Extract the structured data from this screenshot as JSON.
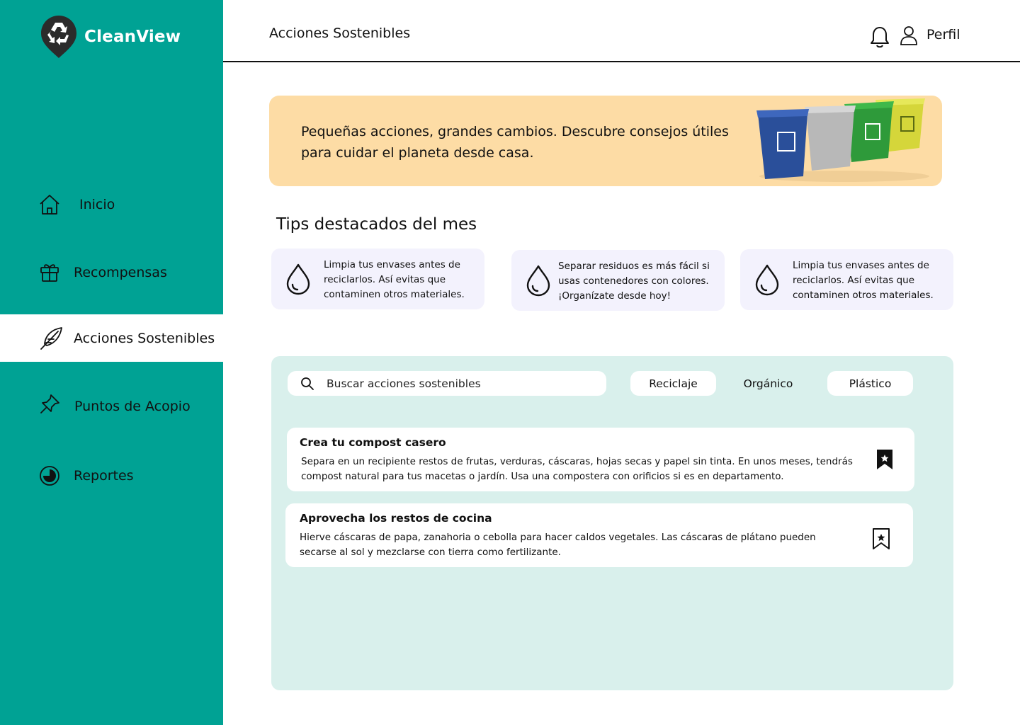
{
  "app": {
    "name": "CleanView"
  },
  "colors": {
    "sidebar": "#00A294",
    "banner": "#FDDCA5",
    "tip_card": "#F3F2FD",
    "panel": "#D9F0EC"
  },
  "sidebar": {
    "items": [
      {
        "label": "Inicio",
        "icon": "home-icon",
        "active": false
      },
      {
        "label": "Recompensas",
        "icon": "gift-icon",
        "active": false
      },
      {
        "label": "Acciones Sostenibles",
        "icon": "feather-icon",
        "active": true
      },
      {
        "label": "Puntos de Acopio",
        "icon": "pushpin-icon",
        "active": false
      },
      {
        "label": "Reportes",
        "icon": "pie-chart-icon",
        "active": false
      }
    ]
  },
  "header": {
    "title": "Acciones Sostenibles",
    "profile_label": "Perfil"
  },
  "banner": {
    "text": "Pequeñas acciones, grandes cambios. Descubre consejos útiles para cuidar el planeta desde casa."
  },
  "tips": {
    "title": "Tips destacados del mes",
    "items": [
      {
        "text": "Limpia tus envases antes de reciclarlos. Así evitas que contaminen otros materiales."
      },
      {
        "text": "Separar residuos es más fácil si usas contenedores con colores. ¡Organízate desde hoy!"
      },
      {
        "text": "Limpia tus envases antes de reciclarlos. Así evitas que contaminen otros materiales."
      }
    ]
  },
  "actions": {
    "search_placeholder": "Buscar acciones sostenibles",
    "filters": [
      {
        "label": "Reciclaje",
        "filled": true
      },
      {
        "label": "Orgánico",
        "filled": false
      },
      {
        "label": "Plástico",
        "filled": true
      }
    ],
    "items": [
      {
        "title": "Crea tu compost casero",
        "description": "Separa en un recipiente restos de frutas, verduras, cáscaras, hojas secas y papel sin tinta. En unos meses, tendrás compost natural para tus macetas o jardín. Usa una compostera con orificios si es en departamento.",
        "saved": true
      },
      {
        "title": "Aprovecha los restos de cocina",
        "description": "Hierve cáscaras de papa, zanahoria o cebolla para hacer caldos vegetales. Las cáscaras de plátano pueden secarse al sol y mezclarse con tierra como fertilizante.",
        "saved": false
      }
    ]
  }
}
